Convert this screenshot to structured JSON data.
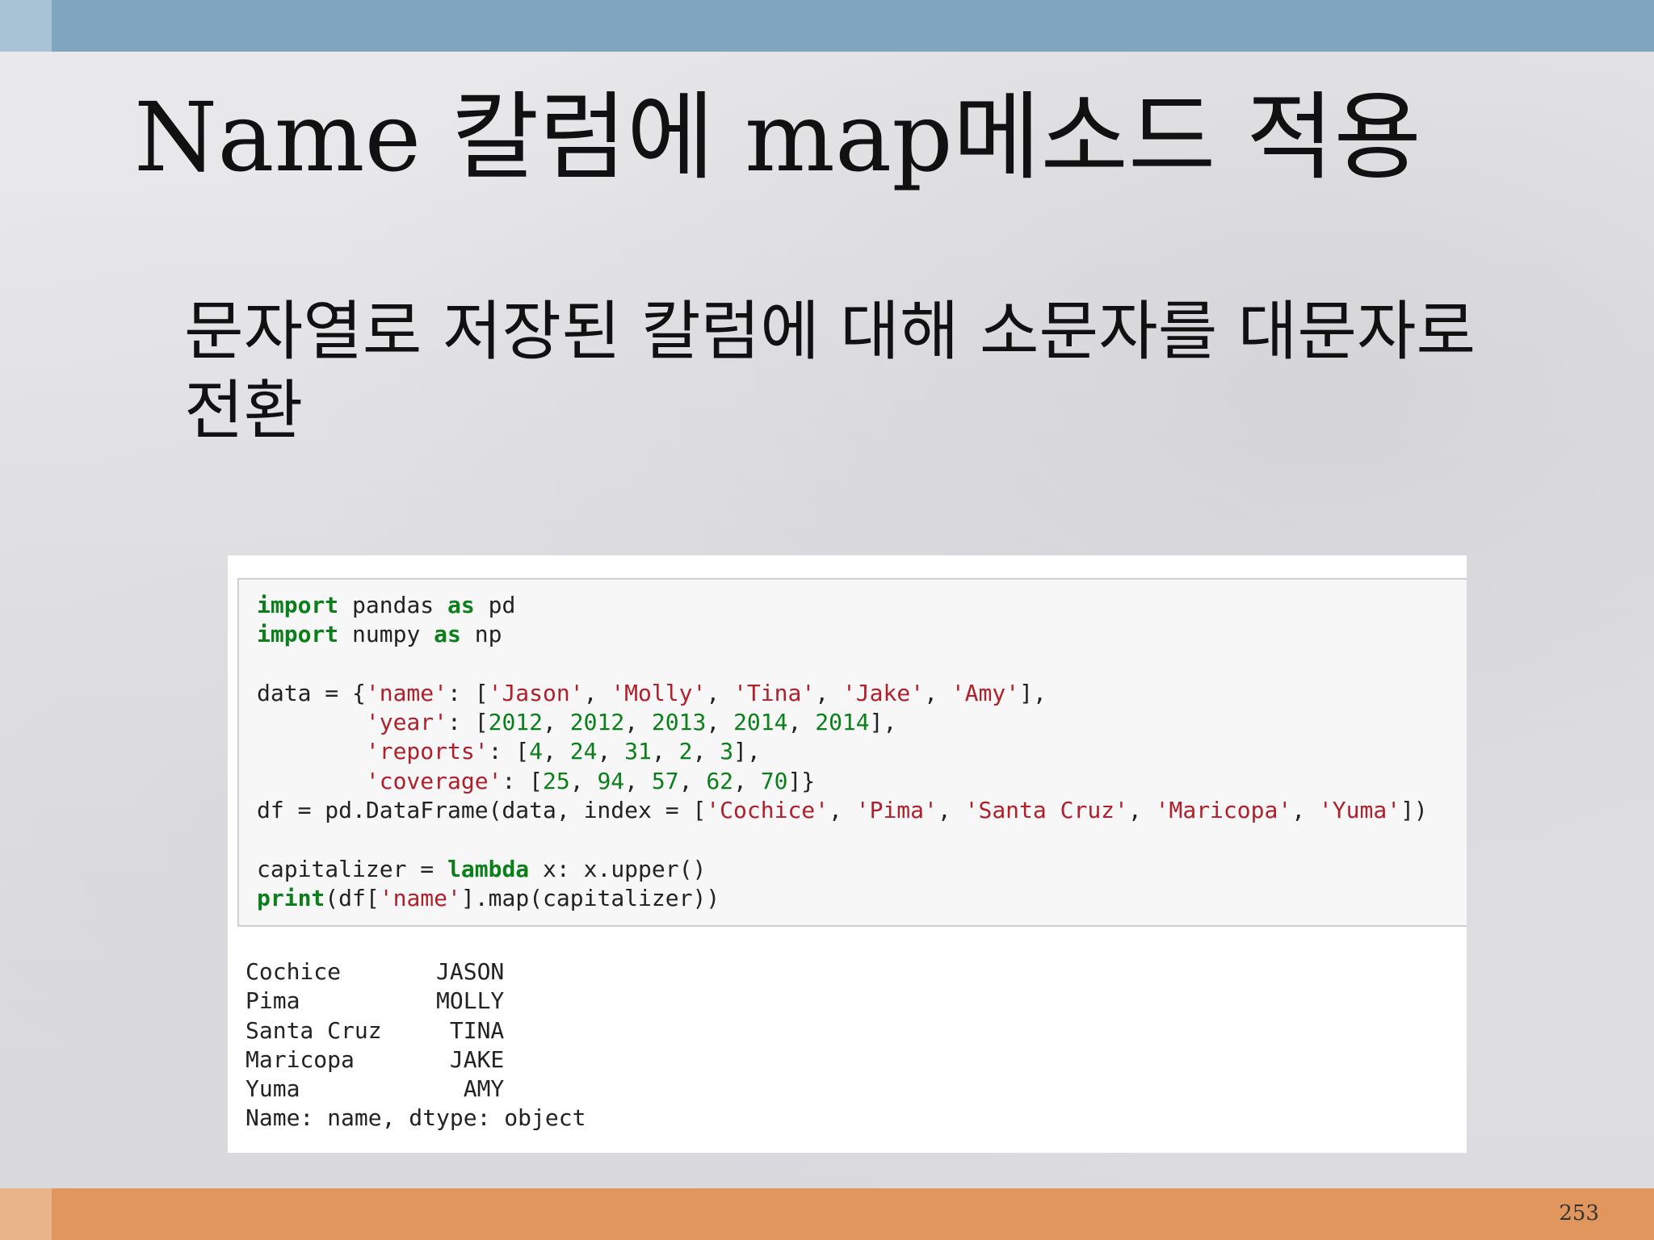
{
  "slide": {
    "title": "Name 칼럼에 map메소드 적용",
    "body_line1": "문자열로 저장된 칼럼에 대해 소문자를 대문자로",
    "body_line2": "전환",
    "page_number": "253"
  },
  "code_cell": {
    "line1": [
      "import",
      " pandas ",
      "as",
      " pd"
    ],
    "line2": [
      "import",
      " numpy ",
      "as",
      " np"
    ],
    "line4_pre": "data = {",
    "name_key": "'name'",
    "line4_mid": ": [",
    "names": [
      "'Jason'",
      "'Molly'",
      "'Tina'",
      "'Jake'",
      "'Amy'"
    ],
    "sep": ", ",
    "line4_end": "],",
    "indent": "        ",
    "year_key": "'year'",
    "years": [
      "2012",
      "2012",
      "2013",
      "2014",
      "2014"
    ],
    "reports_key": "'reports'",
    "reports": [
      "4",
      "24",
      "31",
      "2",
      "3"
    ],
    "coverage_key": "'coverage'",
    "coverage": [
      "25",
      "94",
      "57",
      "62",
      "70"
    ],
    "df_pre": "df = pd.DataFrame(data, index = [",
    "index": [
      "'Cochice'",
      "'Pima'",
      "'Santa Cruz'",
      "'Maricopa'",
      "'Yuma'"
    ],
    "df_end": "])",
    "cap_pre": "capitalizer = ",
    "lambda_kw": "lambda",
    "cap_end": " x: x.upper()",
    "print_kw": "print",
    "print_mid": "(df[",
    "print_key": "'name'",
    "print_end": "].map(capitalizer))"
  },
  "output": {
    "rows": [
      "Cochice       JASON",
      "Pima          MOLLY",
      "Santa Cruz     TINA",
      "Maricopa       JAKE",
      "Yuma            AMY",
      "Name: name, dtype: object"
    ]
  }
}
